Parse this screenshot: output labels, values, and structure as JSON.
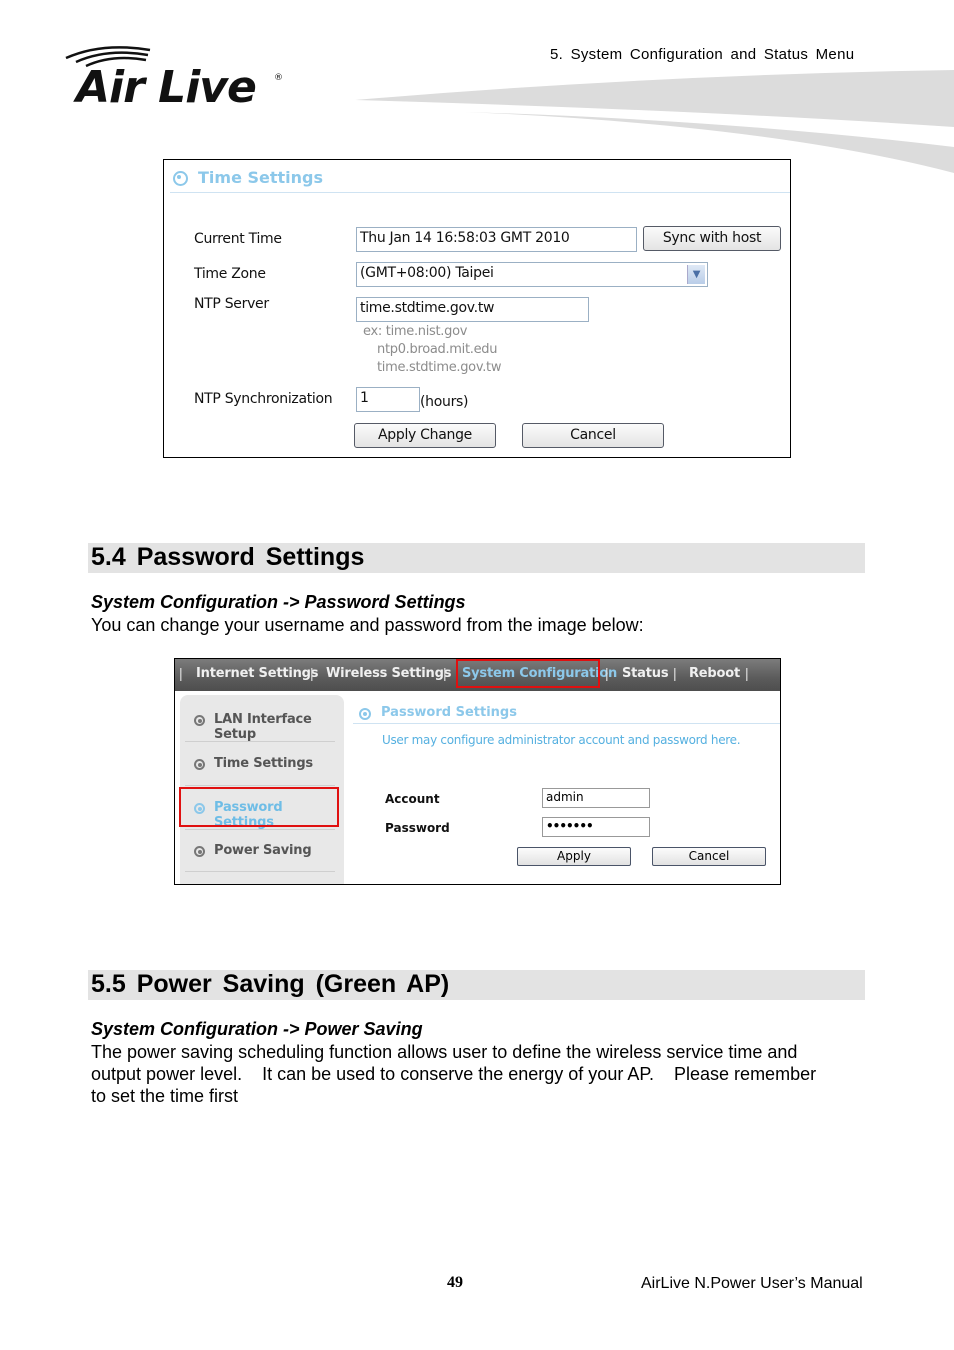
{
  "header": {
    "logo_text": "Air Live",
    "chapter": "5. System Configuration and Status Menu"
  },
  "time_settings_screenshot": {
    "title": "Time Settings",
    "current_time_label": "Current Time",
    "current_time_value": "Thu Jan 14 16:58:03 GMT 2010",
    "sync_button": "Sync with host",
    "time_zone_label": "Time Zone",
    "time_zone_value": "(GMT+08:00) Taipei",
    "ntp_server_label": "NTP Server",
    "ntp_server_value": "time.stdtime.gov.tw",
    "ntp_examples": [
      "ex: time.nist.gov",
      "ntp0.broad.mit.edu",
      "time.stdtime.gov.tw"
    ],
    "ntp_sync_label": "NTP Synchronization",
    "ntp_sync_value": "1",
    "ntp_sync_unit": "(hours)",
    "apply_button": "Apply Change",
    "cancel_button": "Cancel"
  },
  "section_54": {
    "heading": "5.4 Password  Settings",
    "path": "System Configuration -> Password Settings",
    "text": "You can change your username and password from the image below:"
  },
  "password_screenshot": {
    "nav": [
      {
        "label": "Internet Settings"
      },
      {
        "label": "Wireless Settings"
      },
      {
        "label": "System Configuration",
        "active": true
      },
      {
        "label": "Status"
      },
      {
        "label": "Reboot"
      }
    ],
    "sidebar": [
      {
        "label": "LAN Interface Setup"
      },
      {
        "label": "Time Settings"
      },
      {
        "label": "Password Settings",
        "active": true
      },
      {
        "label": "Power Saving"
      }
    ],
    "title": "Password Settings",
    "description": "User may configure administrator account and password here.",
    "account_label": "Account",
    "account_value": "admin",
    "password_label": "Password",
    "password_value": "•••••••",
    "apply_button": "Apply",
    "cancel_button": "Cancel",
    "highlight_color": "#e01010",
    "accent_color": "#8cc8ea"
  },
  "section_55": {
    "heading": "5.5 Power  Saving  (Green  AP)",
    "path": "System Configuration -> Power Saving",
    "lines": [
      "The power saving scheduling function allows user to define the wireless service time and",
      "output power level.    It can be used to conserve the energy of your AP.    Please remember",
      "to set the time first"
    ]
  },
  "footer": {
    "page_number": "49",
    "manual_title": "AirLive N.Power User’s Manual"
  }
}
